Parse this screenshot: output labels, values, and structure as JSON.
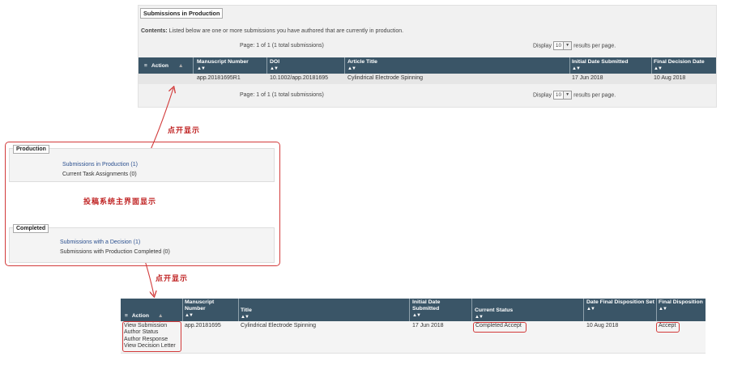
{
  "top": {
    "panel_title": "Submissions in Production",
    "contents_label": "Contents:",
    "contents_text": "Listed below are one or more submissions you have authored that are currently in production.",
    "page_info": "Page: 1 of 1 (1 total submissions)",
    "display_label": "Display",
    "display_value": "10",
    "results_label": "results per page.",
    "sort_glyph": "▲▼",
    "menu_glyph": "≡",
    "action_glyph": "▲",
    "columns": [
      "Action",
      "Manuscript Number",
      "DOI",
      "Article Title",
      "Initial Date Submitted",
      "Final Decision Date"
    ],
    "row": {
      "manuscript_number": "app.20181695R1",
      "doi": "10.1002/app.20181695",
      "article_title": "Cylindrical Electrode Spinning",
      "initial_date": "17 Jun 2018",
      "final_decision_date": "10 Aug 2018"
    }
  },
  "annotations": {
    "click_show_1": "点开显示",
    "main_ui_show": "投稿系统主界面显示",
    "click_show_2": "点开显示"
  },
  "menu": {
    "production_title": "Production",
    "production_items": [
      {
        "label": "Submissions in Production (1)"
      },
      {
        "label": "Current Task Assignments (0)"
      }
    ],
    "completed_title": "Completed",
    "completed_items": [
      {
        "label": "Submissions with a Decision (1)"
      },
      {
        "label": "Submissions with Production Completed (0)"
      }
    ]
  },
  "bottom": {
    "columns": {
      "action": "Action",
      "manuscript_number": "Manuscript Number",
      "title": "Title",
      "initial_date": "Initial Date Submitted",
      "current_status": "Current Status",
      "date_final_disposition": "Date Final Disposition Set",
      "final_disposition": "Final Disposition"
    },
    "actions": [
      "View Submission",
      "Author Status",
      "Author Response",
      "View Decision Letter"
    ],
    "row": {
      "manuscript_number": "app.20181695",
      "title": "Cylindrical Electrode Spinning",
      "initial_date": "17 Jun 2018",
      "current_status": "Completed Accept",
      "date_final_disposition": "10 Aug 2018",
      "final_disposition": "Accept"
    }
  },
  "colors": {
    "header_bg": "#3a5567",
    "annotation_red": "#d23a3a",
    "link_blue": "#2a4f8f"
  }
}
